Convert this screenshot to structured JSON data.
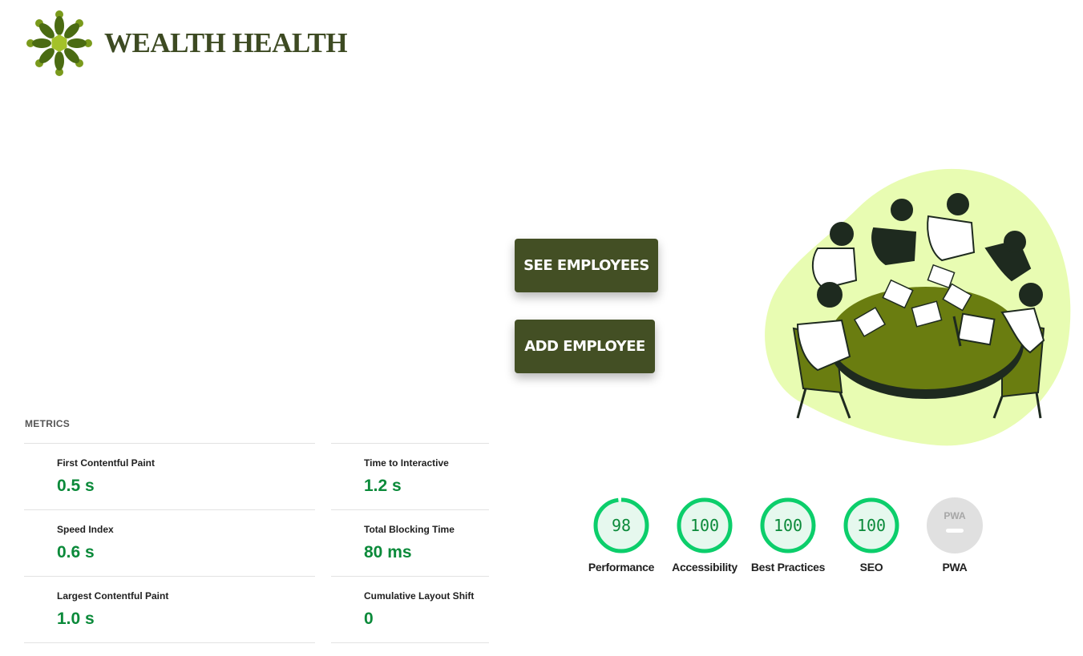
{
  "brand": {
    "name": "WEALTH HEALTH"
  },
  "buttons": {
    "see_employees": "SEE EMPLOYEES",
    "add_employee": "ADD EMPLOYEE"
  },
  "metrics": {
    "title": "METRICS",
    "left": [
      {
        "label": "First Contentful Paint",
        "value": "0.5 s"
      },
      {
        "label": "Speed Index",
        "value": "0.6 s"
      },
      {
        "label": "Largest Contentful Paint",
        "value": "1.0 s"
      }
    ],
    "right": [
      {
        "label": "Time to Interactive",
        "value": "1.2 s"
      },
      {
        "label": "Total Blocking Time",
        "value": "80 ms"
      },
      {
        "label": "Cumulative Layout Shift",
        "value": "0"
      }
    ]
  },
  "scores": [
    {
      "label": "Performance",
      "value": "98",
      "score": 98
    },
    {
      "label": "Accessibility",
      "value": "100",
      "score": 100
    },
    {
      "label": "Best Practices",
      "value": "100",
      "score": 100
    },
    {
      "label": "SEO",
      "value": "100",
      "score": 100
    },
    {
      "label": "PWA",
      "value": "PWA",
      "score": null
    }
  ],
  "colors": {
    "brand_green": "#434f24",
    "pass_green": "#0cce6b",
    "pass_text": "#0b8a3a",
    "pass_bg": "#e6f8ee",
    "illustration_blob": "#e8fcb2",
    "table_green": "#6a7d10"
  }
}
